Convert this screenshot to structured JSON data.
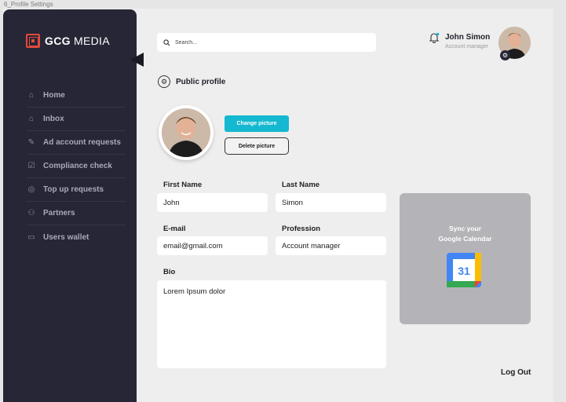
{
  "frame_label": "6_Profile Settings",
  "brand": {
    "bold": "GCG",
    "rest": "MEDIA",
    "accent": "#e44a3c"
  },
  "sidebar": {
    "items": [
      {
        "label": "Home",
        "icon": "home-icon"
      },
      {
        "label": "Inbox",
        "icon": "inbox-icon"
      },
      {
        "label": "Ad account requests",
        "icon": "edit-icon"
      },
      {
        "label": "Compliance check",
        "icon": "checklist-icon"
      },
      {
        "label": "Top up requests",
        "icon": "coins-icon"
      },
      {
        "label": "Partners",
        "icon": "partners-icon"
      },
      {
        "label": "Users wallet",
        "icon": "wallet-icon"
      }
    ]
  },
  "search": {
    "placeholder": "Search..."
  },
  "header": {
    "user_name": "John Simon",
    "user_role": "Account manager"
  },
  "profile": {
    "section_title": "Public profile",
    "change_picture": "Change picture",
    "delete_picture": "Delete picture",
    "first_name_label": "First Name",
    "first_name": "John",
    "last_name_label": "Last Name",
    "last_name": "Simon",
    "email_label": "E-mail",
    "email": "email@gmail.com",
    "profession_label": "Profession",
    "profession": "Account manager",
    "bio_label": "Bio",
    "bio": "Lorem Ipsum dolor"
  },
  "calendar_card": {
    "line1": "Sync your",
    "line2": "Google Calendar",
    "icon_number": "31"
  },
  "logout": "Log Out",
  "colors": {
    "sidebar": "#262636",
    "primary_button": "#14b8d0",
    "card": "#b4b4b8"
  }
}
